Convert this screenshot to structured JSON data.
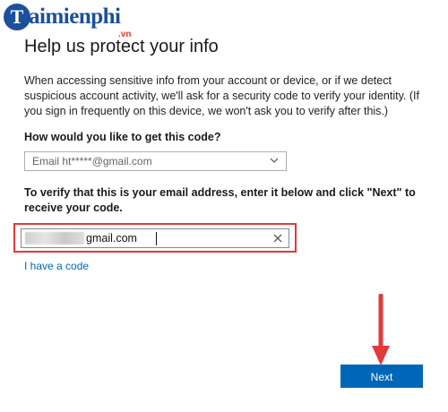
{
  "brand": {
    "logo_letter": "T",
    "logo_text": "aimienphi",
    "logo_suffix": ".vn"
  },
  "page": {
    "title": "Help us protect your info",
    "description": "When accessing sensitive info from your account or device, or if we detect suspicious account activity, we'll ask for a security code to verify your identity. (If you sign in frequently on this device, we won't ask you to verify after this.)",
    "question": "How would you like to get this code?",
    "method_select": {
      "selected": "Email ht*****@gmail.com"
    },
    "instruction": "To verify that this is your email address, enter it below and click \"Next\" to receive your code.",
    "email_input": {
      "value": "gmail.com"
    },
    "have_code_link": "I have a code",
    "next_button": "Next"
  },
  "colors": {
    "accent": "#0067b8",
    "highlight": "#e03a3a",
    "brand": "#1c4f9c"
  },
  "icons": [
    "chevron-down-icon",
    "clear-icon",
    "down-arrow-annotation-icon"
  ]
}
